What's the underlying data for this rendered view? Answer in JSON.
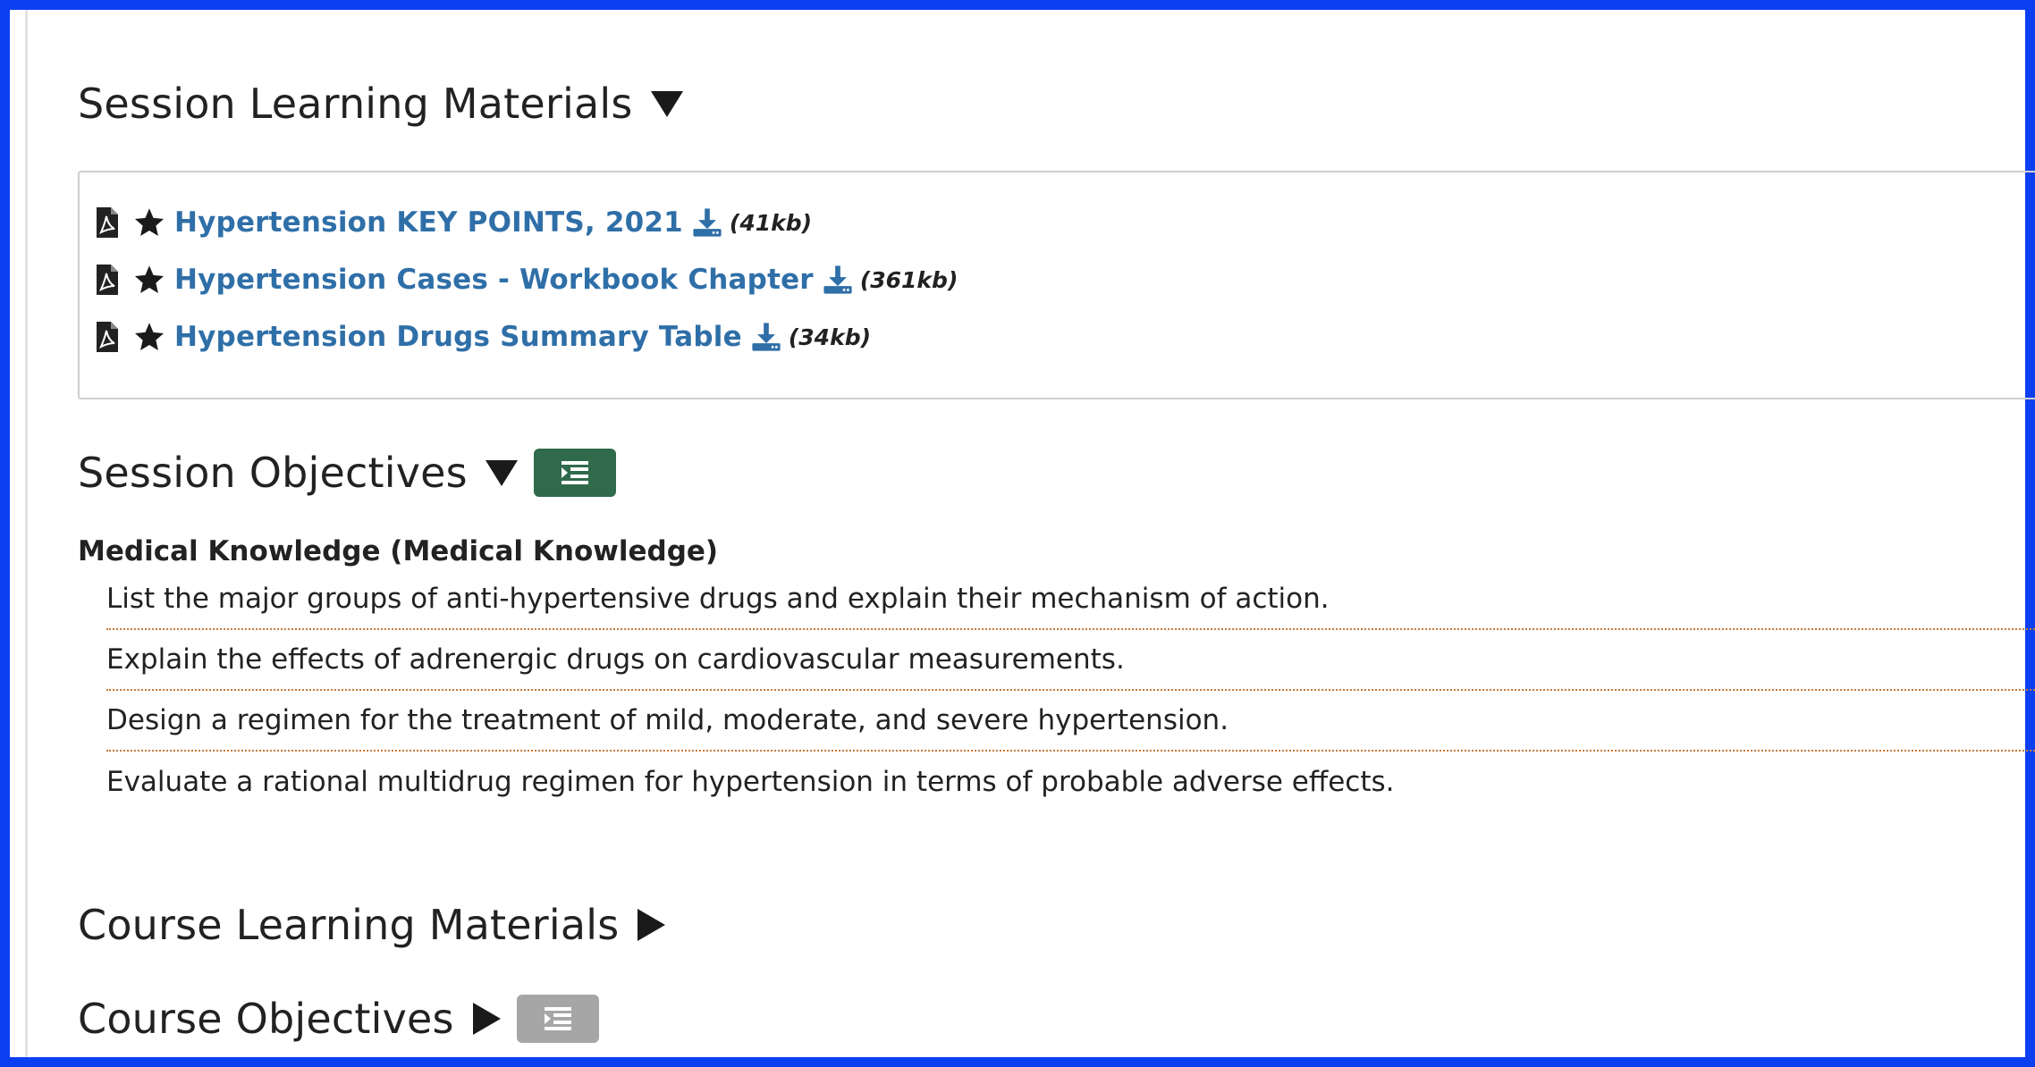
{
  "session_materials": {
    "title": "Session Learning Materials",
    "expanded": true,
    "items": [
      {
        "label": "Hypertension KEY POINTS, 2021",
        "size": "(41kb)",
        "icon": "file-pdf-icon"
      },
      {
        "label": "Hypertension Cases - Workbook Chapter",
        "size": "(361kb)",
        "icon": "file-pdf-icon"
      },
      {
        "label": "Hypertension Drugs Summary Table",
        "size": "(34kb)",
        "icon": "file-pdf-icon"
      }
    ]
  },
  "session_objectives": {
    "title": "Session Objectives",
    "expanded": true,
    "toggle_active_color": "#2f6a4b",
    "group_title": "Medical Knowledge (Medical Knowledge)",
    "items": [
      "List the major groups of anti-hypertensive drugs and explain their mechanism of action.",
      "Explain the effects of adrenergic drugs on cardiovascular measurements.",
      "Design a regimen for the treatment of mild, moderate, and severe hypertension.",
      "Evaluate a rational multidrug regimen for hypertension in terms of probable adverse effects."
    ]
  },
  "course_materials": {
    "title": "Course Learning Materials",
    "expanded": false
  },
  "course_objectives": {
    "title": "Course Objectives",
    "expanded": false,
    "toggle_inactive_color": "#a6a6a6"
  },
  "colors": {
    "frame_border": "#0b3ff0",
    "link": "#2f6fa8",
    "divider": "#c77a3a"
  }
}
